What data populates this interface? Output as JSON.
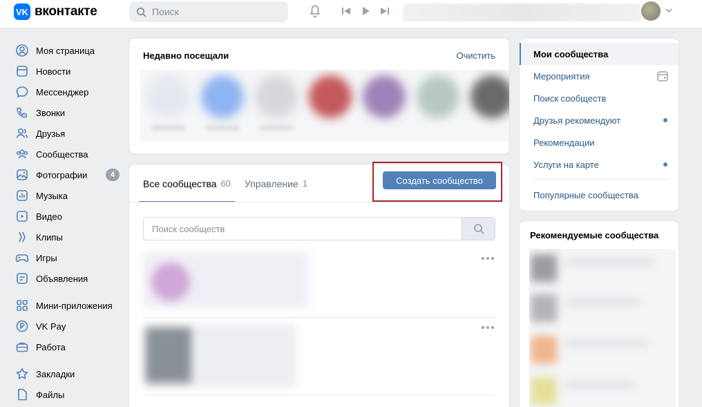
{
  "header": {
    "logo_mark": "VK",
    "logo_text": "вконтакте",
    "search_placeholder": "Поиск"
  },
  "leftnav": {
    "items": [
      {
        "label": "Моя страница",
        "icon": "user-circle-icon"
      },
      {
        "label": "Новости",
        "icon": "newsfeed-icon"
      },
      {
        "label": "Мессенджер",
        "icon": "message-icon"
      },
      {
        "label": "Звонки",
        "icon": "phone-icon"
      },
      {
        "label": "Друзья",
        "icon": "friends-icon"
      },
      {
        "label": "Сообщества",
        "icon": "communities-icon"
      },
      {
        "label": "Фотографии",
        "icon": "photo-icon",
        "badge": "4"
      },
      {
        "label": "Музыка",
        "icon": "music-icon"
      },
      {
        "label": "Видео",
        "icon": "video-icon"
      },
      {
        "label": "Клипы",
        "icon": "clips-icon"
      },
      {
        "label": "Игры",
        "icon": "gamepad-icon"
      },
      {
        "label": "Объявления",
        "icon": "ads-icon"
      },
      {
        "label": "Мини-приложения",
        "icon": "apps-icon"
      },
      {
        "label": "VK Pay",
        "icon": "vkpay-icon"
      },
      {
        "label": "Работа",
        "icon": "briefcase-icon"
      },
      {
        "label": "Закладки",
        "icon": "star-icon"
      },
      {
        "label": "Файлы",
        "icon": "file-icon"
      }
    ]
  },
  "recent": {
    "title": "Недавно посещали",
    "clear_label": "Очистить"
  },
  "main": {
    "tabs": [
      {
        "label": "Все сообщества",
        "count": "60"
      },
      {
        "label": "Управление",
        "count": "1"
      }
    ],
    "create_label": "Создать сообщество",
    "search_placeholder": "Поиск сообществ"
  },
  "rightnav": {
    "items": [
      {
        "label": "Мои сообщества"
      },
      {
        "label": "Мероприятия"
      },
      {
        "label": "Поиск сообществ"
      },
      {
        "label": "Друзья рекомендуют"
      },
      {
        "label": "Рекомендации"
      },
      {
        "label": "Услуги на карте"
      },
      {
        "label": "Популярные сообщества"
      }
    ]
  },
  "recommended": {
    "title": "Рекомендуемые сообщества"
  },
  "colors": {
    "accent": "#5181b8",
    "link": "#2a5885",
    "highlight_border": "#a9252a",
    "brand": "#0077ff"
  }
}
